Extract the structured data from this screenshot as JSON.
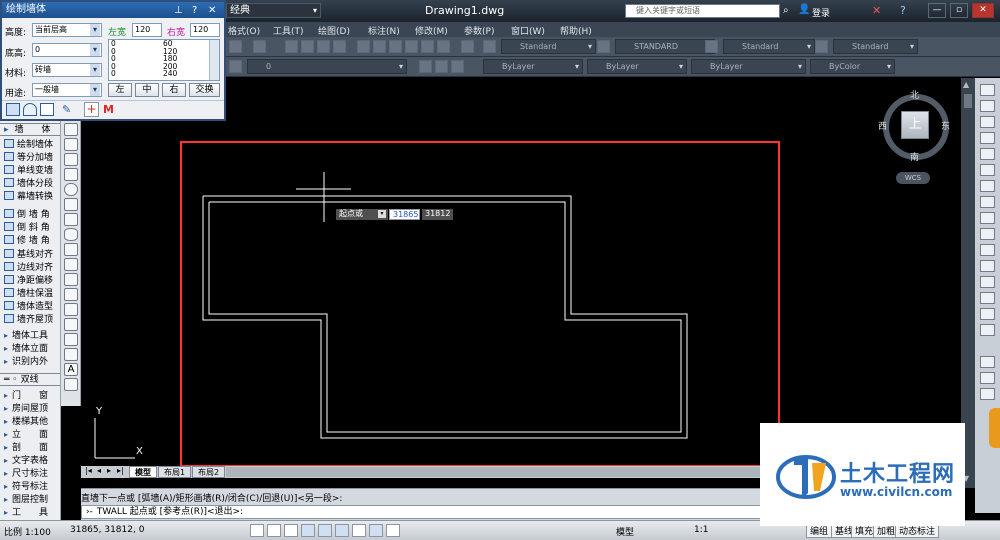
{
  "title_bar": {
    "workspace_value": "经典",
    "document_title": "Drawing1.dwg",
    "search_placeholder": "键入关键字或短语",
    "login_label": "登录"
  },
  "menu_bar": {
    "items": [
      "格式(O)",
      "工具(T)",
      "绘图(D)",
      "标注(N)",
      "修改(M)",
      "参数(P)",
      "窗口(W)",
      "帮助(H)"
    ]
  },
  "toolbar_styles": {
    "text_style": "Standard",
    "dim_style": "STANDARD",
    "table_style": "Standard",
    "multileader_style": "Standard"
  },
  "properties_bar": {
    "layer": "0",
    "color": "ByLayer",
    "linetype": "ByLayer",
    "lineweight": "ByLayer",
    "plotstyle": "ByColor"
  },
  "wall_panel": {
    "title": "绘制墙体",
    "height_label": "高度:",
    "height_value": "当前层高",
    "left_width_label": "左宽",
    "left_width_value": "120",
    "right_width_label": "右宽",
    "right_width_value": "120",
    "base_height_label": "底高:",
    "base_height_value": "0",
    "material_label": "材料:",
    "material_value": "砖墙",
    "usage_label": "用途:",
    "usage_value": "一般墙",
    "width_list_left": [
      "0",
      "0",
      "0",
      "0",
      "0"
    ],
    "width_list_right": [
      "60",
      "120",
      "180",
      "200",
      "240"
    ],
    "buttons": {
      "left": "左",
      "center": "中",
      "right": "右",
      "swap": "交换"
    }
  },
  "left_menu": {
    "section_title": "墙　　体",
    "items": [
      "绘制墙体",
      "等分加墙",
      "单线变墙",
      "墙体分段",
      "幕墙转换",
      "倒 墙 角",
      "倒 斜 角",
      "修 墙 角",
      "基线对齐",
      "边线对齐",
      "净距偏移",
      "墙柱保温",
      "墙体造型",
      "墙齐屋顶"
    ],
    "sub_items": [
      "墙体工具",
      "墙体立面",
      "识别内外"
    ],
    "section2_title": "双线",
    "lower_items": [
      "门　　窗",
      "房间屋顶",
      "楼梯其他",
      "立　　面",
      "剖　　面",
      "文字表格",
      "尺寸标注",
      "符号标注",
      "图层控制",
      "工　　具"
    ]
  },
  "viewcube": {
    "north": "北",
    "south": "南",
    "east": "东",
    "west": "西",
    "top": "上",
    "wcs": "WCS"
  },
  "dynamic_input": {
    "prompt": "起点或",
    "x_value": "31865",
    "y_value": "31812"
  },
  "layout_tabs": [
    "模型",
    "布局1",
    "布局2"
  ],
  "command_line": {
    "history": "直墙下一点或 [弧墙(A)/矩形画墙(R)/闭合(C)/回退(U)]<另一段>:",
    "current": "TWALL 起点或 [参考点(R)]<退出>:"
  },
  "status_bar": {
    "scale": "比例 1:100",
    "coordinates": "31865, 31812, 0",
    "model_label": "模型",
    "annotation_scale": "1:1",
    "buttons": [
      "编组",
      "基线",
      "填充",
      "加粗",
      "动态标注"
    ]
  },
  "watermark": {
    "brand": "土木工程网",
    "url": "www.civilcn.com"
  },
  "colors": {
    "canvas": "#000000",
    "drawing_frame": "#ff3333",
    "walls": "#ffffff",
    "panel_title": "#1c4f8d",
    "accent_red": "#e0261f"
  }
}
